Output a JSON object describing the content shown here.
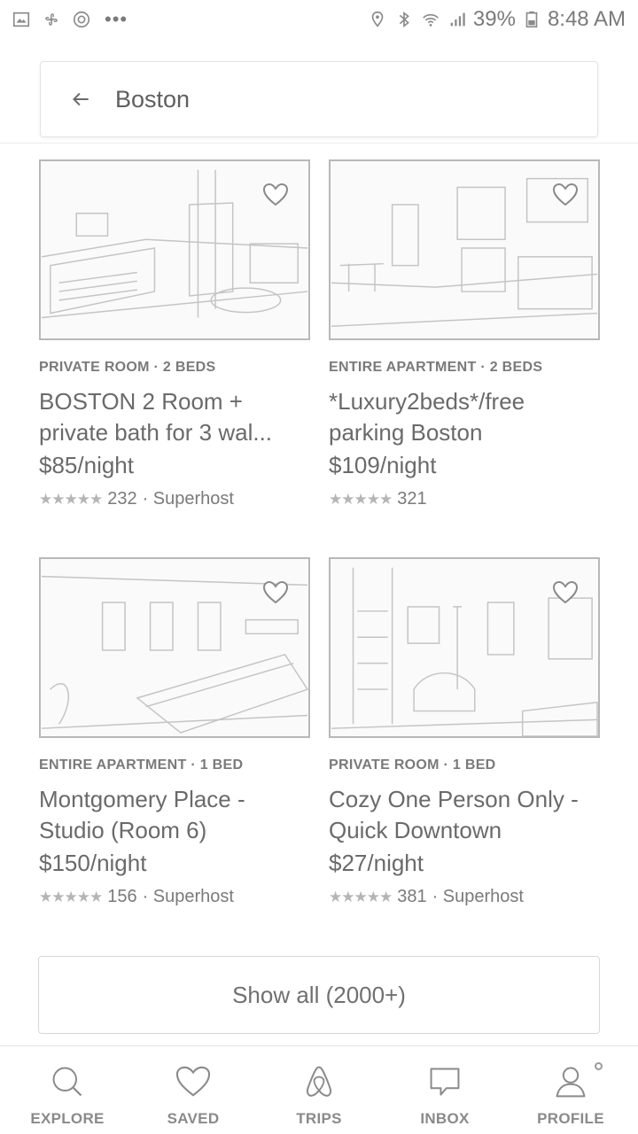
{
  "status_bar": {
    "left_icons": [
      "gallery-icon",
      "pinwheel-icon",
      "sync-icon",
      "more-dots-icon"
    ],
    "more_glyph": "•••",
    "battery": "39%",
    "time": "8:48 AM"
  },
  "search": {
    "query": "Boston"
  },
  "listings": [
    {
      "type": "PRIVATE ROOM · 2 BEDS",
      "title_line1": "BOSTON 2 Room +",
      "title_line2": "private bath for 3 wal...",
      "price": "$85/night",
      "stars": "★★★★★",
      "reviews": "232",
      "badge": "· Superhost"
    },
    {
      "type": "ENTIRE APARTMENT · 2 BEDS",
      "title_line1": "*Luxury2beds*/free",
      "title_line2": "parking Boston",
      "price": "$109/night",
      "stars": "★★★★★",
      "reviews": "321",
      "badge": ""
    },
    {
      "type": "ENTIRE APARTMENT · 1 BED",
      "title_line1": "Montgomery Place -",
      "title_line2": "Studio (Room 6)",
      "price": "$150/night",
      "stars": "★★★★★",
      "reviews": "156",
      "badge": "· Superhost"
    },
    {
      "type": "PRIVATE ROOM · 1 BED",
      "title_line1": "Cozy One Person Only -",
      "title_line2": "Quick Downtown",
      "price": "$27/night",
      "stars": "★★★★★",
      "reviews": "381",
      "badge": "· Superhost"
    }
  ],
  "show_all_label": "Show all (2000+)",
  "bottom_nav": {
    "explore": "EXPLORE",
    "saved": "SAVED",
    "trips": "TRIPS",
    "inbox": "INBOX",
    "profile": "PROFILE"
  }
}
